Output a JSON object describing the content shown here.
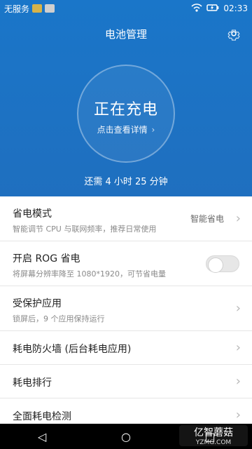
{
  "status_bar": {
    "carrier": "无服务",
    "time": "02:33",
    "icons": [
      "notification-icon",
      "sim-icon",
      "wifi-icon",
      "battery-icon"
    ]
  },
  "header": {
    "title": "电池管理",
    "charging_text": "正在充电",
    "details_link": "点击查看详情",
    "remaining_text": "还需 4 小时 25 分钟"
  },
  "settings": {
    "power_mode": {
      "label": "省电模式",
      "subtitle": "智能调节 CPU 与联网频率，推荐日常使用",
      "value": "智能省电"
    },
    "rog": {
      "label": "开启 ROG 省电",
      "subtitle": "将屏幕分辨率降至 1080*1920，可节省电量",
      "enabled": false
    },
    "protected_apps": {
      "label": "受保护应用",
      "subtitle": "锁屏后，9 个应用保持运行"
    },
    "power_firewall": {
      "label": "耗电防火墙 (后台耗电应用)"
    },
    "power_ranking": {
      "label": "耗电排行"
    },
    "full_check": {
      "label": "全面耗电检测"
    }
  },
  "watermark": {
    "brand": "亿智蘑菇",
    "domain": "YZMG.COM"
  },
  "colors": {
    "header_blue": "#1f6fbf",
    "text_dark": "#222222",
    "text_muted": "#8a8a8a"
  }
}
